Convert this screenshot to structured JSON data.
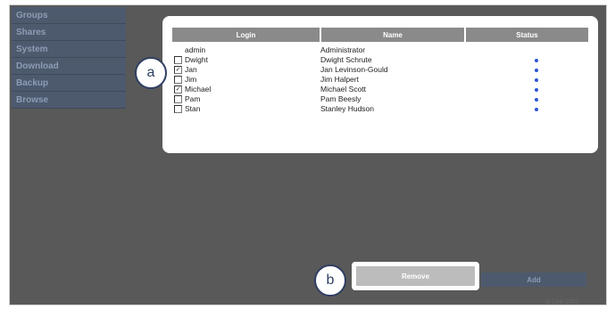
{
  "sidebar": {
    "items": [
      {
        "label": "Groups"
      },
      {
        "label": "Shares"
      },
      {
        "label": "System"
      },
      {
        "label": "Download"
      },
      {
        "label": "Backup"
      },
      {
        "label": "Browse"
      }
    ]
  },
  "table": {
    "headers": {
      "login": "Login",
      "name": "Name",
      "status": "Status"
    },
    "rows": [
      {
        "login": "admin",
        "name": "Administrator",
        "checkbox": false,
        "checked": false,
        "status": false
      },
      {
        "login": "Dwight",
        "name": "Dwight Schrute",
        "checkbox": true,
        "checked": false,
        "status": true
      },
      {
        "login": "Jan",
        "name": "Jan Levinson-Gould",
        "checkbox": true,
        "checked": true,
        "status": true
      },
      {
        "login": "Jim",
        "name": "Jim Halpert",
        "checkbox": true,
        "checked": false,
        "status": true
      },
      {
        "login": "Michael",
        "name": "Michael Scott",
        "checkbox": true,
        "checked": true,
        "status": true
      },
      {
        "login": "Pam",
        "name": "Pam Beesly",
        "checkbox": true,
        "checked": false,
        "status": true
      },
      {
        "login": "Stan",
        "name": "Stanley Hudson",
        "checkbox": true,
        "checked": false,
        "status": true
      }
    ]
  },
  "buttons": {
    "remove_label": "Remove",
    "add_label": "Add"
  },
  "callouts": {
    "a": "a",
    "b": "b"
  },
  "footer": {
    "text": "D-Link 2001"
  },
  "colors": {
    "status_dot": "#2a56d6",
    "sidebar": "#4d5a6e",
    "background": "#595959",
    "header": "#8a8a8a"
  }
}
